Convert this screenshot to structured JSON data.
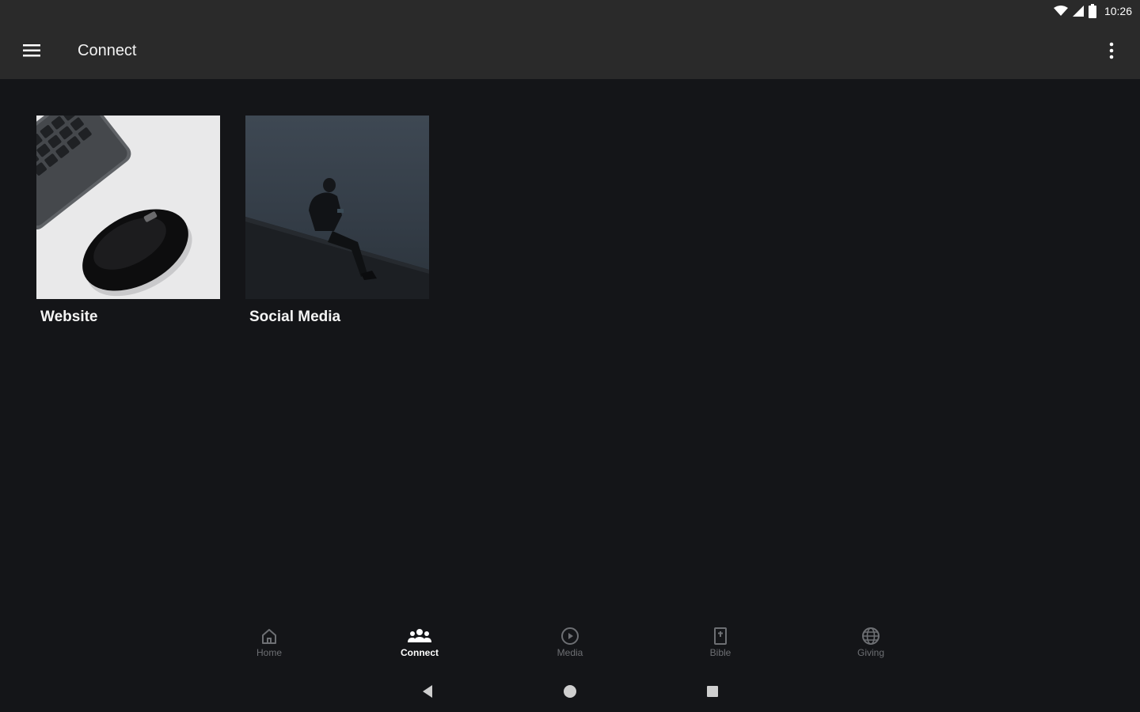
{
  "status_bar": {
    "time": "10:26",
    "icons": [
      "wifi-icon",
      "cell-signal-icon",
      "battery-icon"
    ]
  },
  "app_bar": {
    "title": "Connect",
    "menu_icon": "hamburger-menu-icon",
    "overflow_icon": "more-vert-icon"
  },
  "tiles": [
    {
      "label": "Website",
      "image": "computer mouse and keyboard photo"
    },
    {
      "label": "Social Media",
      "image": "person sitting on slope using phone photo"
    }
  ],
  "bottom_nav": {
    "items": [
      {
        "label": "Home",
        "icon": "home-icon",
        "active": false
      },
      {
        "label": "Connect",
        "icon": "group-icon",
        "active": true
      },
      {
        "label": "Media",
        "icon": "play-circle-icon",
        "active": false
      },
      {
        "label": "Bible",
        "icon": "bible-icon",
        "active": false
      },
      {
        "label": "Giving",
        "icon": "globe-icon",
        "active": false
      }
    ]
  },
  "system_nav": {
    "buttons": [
      "back-icon",
      "home-circle-icon",
      "recents-icon"
    ]
  },
  "colors": {
    "background": "#141518",
    "app_bar": "#2a2a2a",
    "nav_inactive": "#6d6f73",
    "nav_active": "#ffffff"
  }
}
